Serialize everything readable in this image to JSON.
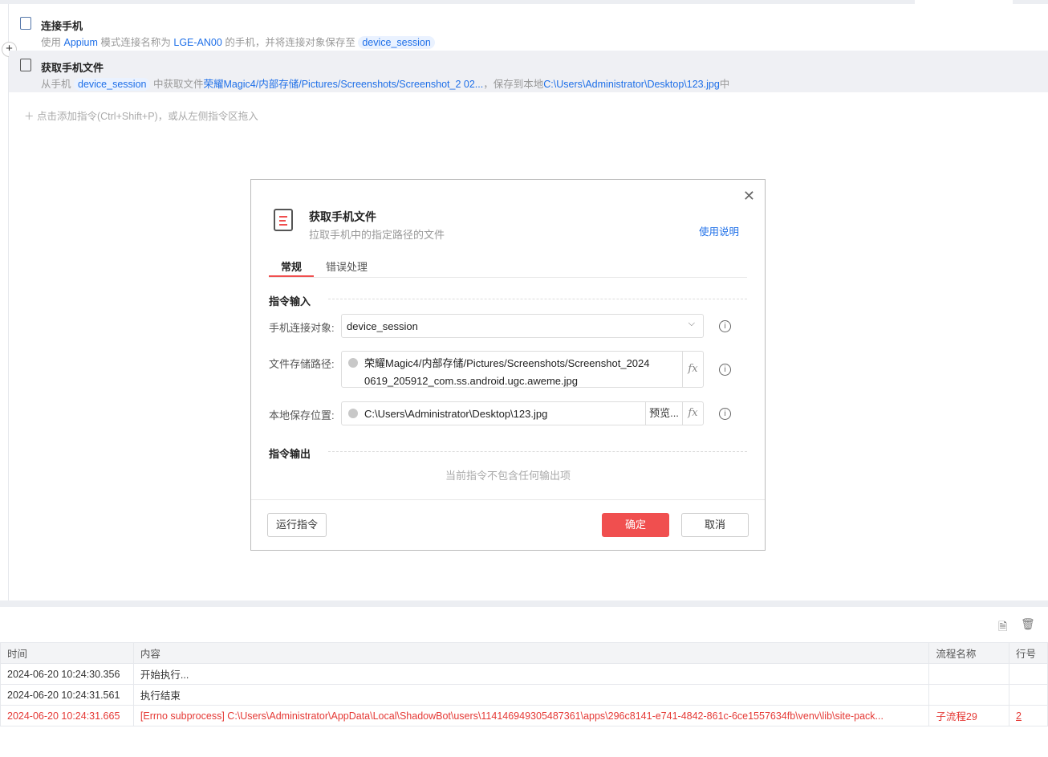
{
  "steps": [
    {
      "title": "连接手机",
      "desc": {
        "p1": "使用",
        "p2": "Appium",
        "p3": "模式连接名称为",
        "p4": "LGE-AN00",
        "p5": "的手机，并将连接对象保存至",
        "p6": "device_session"
      }
    },
    {
      "title": "获取手机文件",
      "desc": {
        "p1": "从手机",
        "p2": "device_session",
        "p3": "中获取文件",
        "p4": "荣耀Magic4/内部存储/Pictures/Screenshots/Screenshot_2 02...",
        "p5": "，保存到本地",
        "p6": "C:\\Users\\Administrator\\Desktop\\123.jpg",
        "p7": "中"
      }
    }
  ],
  "add_hint": "点击添加指令(Ctrl+Shift+P)，或从左侧指令区拖入",
  "dialog": {
    "title": "获取手机文件",
    "subtitle": "拉取手机中的指定路径的文件",
    "help": "使用说明",
    "tabs": [
      "常规",
      "错误处理"
    ],
    "input_section": "指令输入",
    "output_section": "指令输出",
    "fields": {
      "device": {
        "label": "手机连接对象:",
        "value": "device_session"
      },
      "path": {
        "label": "文件存储路径:",
        "value": "荣耀Magic4/内部存储/Pictures/Screenshots/Screenshot_20240619_205912_com.ss.android.ugc.aweme.jpg"
      },
      "local": {
        "label": "本地保存位置:",
        "value": "C:\\Users\\Administrator\\Desktop\\123.jpg",
        "browse": "预览..."
      }
    },
    "fx": "fx",
    "no_output": "当前指令不包含任何输出项",
    "run": "运行指令",
    "ok": "确定",
    "cancel": "取消"
  },
  "log": {
    "columns": [
      "时间",
      "内容",
      "流程名称",
      "行号"
    ],
    "rows": [
      {
        "time": "2024-06-20 10:24:30.356",
        "content": "开始执行...",
        "flow": "",
        "line": ""
      },
      {
        "time": "2024-06-20 10:24:31.561",
        "content": "执行结束",
        "flow": "",
        "line": ""
      },
      {
        "time": "2024-06-20 10:24:31.665",
        "content": "[Errno subprocess] C:\\Users\\Administrator\\AppData\\Local\\ShadowBot\\users\\114146949305487361\\apps\\296c8141-e741-4842-861c-6ce1557634fb\\venv\\lib\\site-pack...",
        "flow": "子流程29",
        "line": "2"
      }
    ]
  },
  "colors": {
    "accent": "#f04f4f",
    "link": "#1e6fe8",
    "error": "#e53935"
  }
}
